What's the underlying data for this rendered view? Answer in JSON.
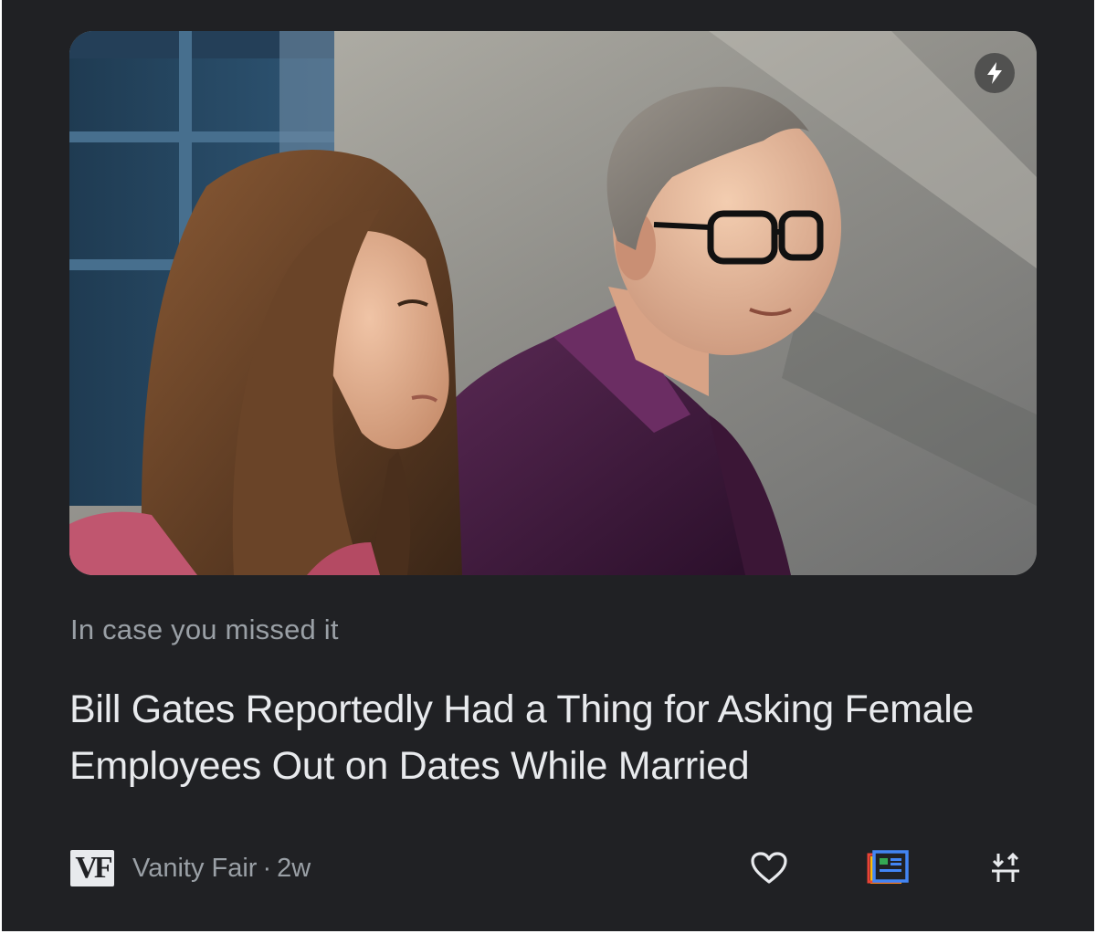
{
  "card": {
    "hero_image_alt": "Bill Gates and Melinda Gates walking outdoors",
    "kicker": "In case you missed it",
    "headline": "Bill Gates Reportedly Had a Thing for Asking Female Employees Out on Dates While Married",
    "source": {
      "logo_text": "VF",
      "name": "Vanity Fair",
      "separator": "·",
      "age": "2w"
    },
    "actions": [
      {
        "name": "like",
        "icon": "heart-outline-icon"
      },
      {
        "name": "full-coverage",
        "icon": "full-coverage-icon"
      },
      {
        "name": "more-options",
        "icon": "sort-arrows-icon"
      }
    ],
    "badge_icon": "lightning-bolt-icon"
  },
  "colors": {
    "card_background": "#202124",
    "headline_text": "#e8eaed",
    "meta_text": "#9aa0a6",
    "full_coverage_blue": "#4285f4",
    "full_coverage_red": "#ea4335",
    "full_coverage_yellow": "#fbbc04",
    "full_coverage_green": "#34a853"
  }
}
